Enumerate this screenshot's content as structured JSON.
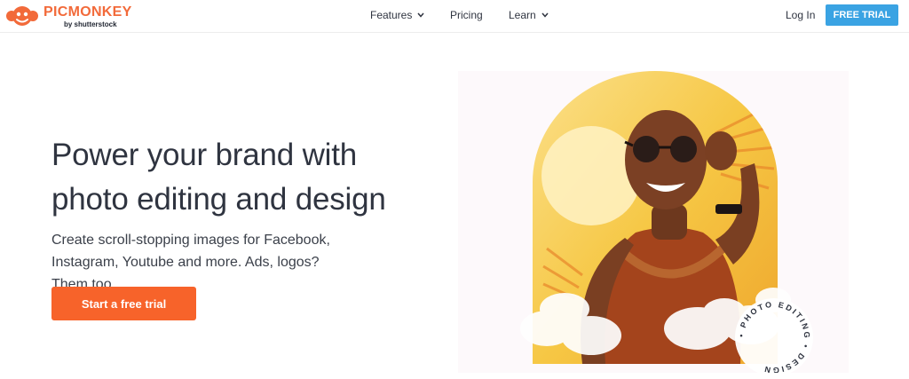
{
  "brand": {
    "name": "PICMONKEY",
    "sub": "by shutterstock",
    "color": "#f26a3a"
  },
  "nav": {
    "items": [
      {
        "label": "Features",
        "dropdown": true
      },
      {
        "label": "Pricing",
        "dropdown": false
      },
      {
        "label": "Learn",
        "dropdown": true
      }
    ],
    "login": "Log In",
    "trial": "FREE TRIAL",
    "trial_color": "#3aa3e3"
  },
  "hero": {
    "title_line1": "Power your brand with",
    "title_line2": "photo editing and design",
    "subtitle_line1": "Create scroll-stopping images for Facebook,",
    "subtitle_line2": "Instagram, Youtube and more. Ads, logos? Them too.",
    "cta": "Start a free trial",
    "cta_color": "#f7632a"
  },
  "badge": {
    "text": "• PHOTO EDITING • DESIGN"
  }
}
